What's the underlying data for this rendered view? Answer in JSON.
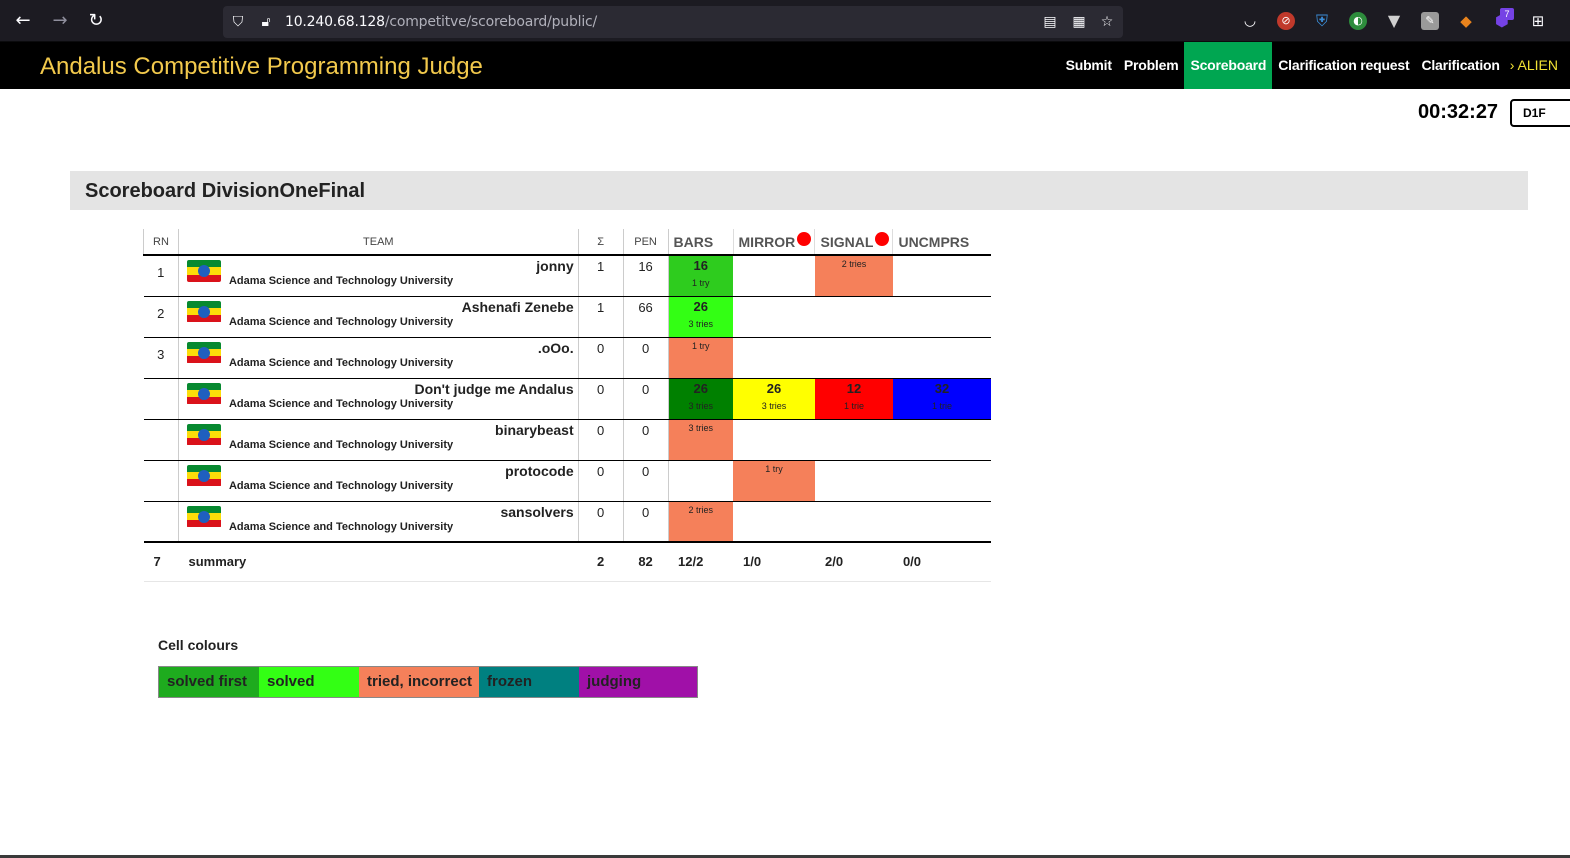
{
  "browser": {
    "url_host": "10.240.68.128",
    "url_path": "/competitve/scoreboard/public/",
    "extension_badge": "7"
  },
  "site": {
    "title": "Andalus Competitive Programming Judge",
    "nav": [
      "Submit",
      "Problem",
      "Scoreboard",
      "Clarification request",
      "Clarification"
    ],
    "active_nav": "Scoreboard",
    "user": "› ALIEN"
  },
  "clock": "00:32:27",
  "division": "D1F",
  "scoreboard": {
    "title": "Scoreboard DivisionOneFinal",
    "headers": {
      "rank": "RN",
      "team": "TEAM",
      "score": "Σ",
      "pen": "PEN"
    },
    "problems": [
      {
        "name": "BARS",
        "balloon": "#ffffff"
      },
      {
        "name": "MIRROR",
        "balloon": "#ff0000"
      },
      {
        "name": "SIGNAL",
        "balloon": "#ff0000"
      },
      {
        "name": "UNCMPRS",
        "balloon": "#ffffff"
      }
    ],
    "rows": [
      {
        "rank": "1",
        "team": "jonny",
        "affiliation": "Adama Science and Technology University",
        "score": "1",
        "pen": "16",
        "cells": [
          {
            "value": "16",
            "tries": "1 try",
            "color": "#2ecc1e"
          },
          {
            "value": "",
            "tries": "",
            "color": ""
          },
          {
            "value": "",
            "tries": "2 tries",
            "color": "#f5805a"
          },
          {
            "value": "",
            "tries": "",
            "color": ""
          }
        ]
      },
      {
        "rank": "2",
        "team": "Ashenafi Zenebe",
        "affiliation": "Adama Science and Technology University",
        "score": "1",
        "pen": "66",
        "cells": [
          {
            "value": "26",
            "tries": "3 tries",
            "color": "#33ff14"
          },
          {
            "value": "",
            "tries": "",
            "color": ""
          },
          {
            "value": "",
            "tries": "",
            "color": ""
          },
          {
            "value": "",
            "tries": "",
            "color": ""
          }
        ]
      },
      {
        "rank": "3",
        "team": ".oOo.",
        "affiliation": "Adama Science and Technology University",
        "score": "0",
        "pen": "0",
        "cells": [
          {
            "value": "",
            "tries": "1 try",
            "color": "#f5805a"
          },
          {
            "value": "",
            "tries": "",
            "color": ""
          },
          {
            "value": "",
            "tries": "",
            "color": ""
          },
          {
            "value": "",
            "tries": "",
            "color": ""
          }
        ]
      },
      {
        "rank": "",
        "team": "Don't judge me Andalus",
        "affiliation": "Adama Science and Technology University",
        "score": "0",
        "pen": "0",
        "cells": [
          {
            "value": "26",
            "tries": "3 tries",
            "color": "#008000"
          },
          {
            "value": "26",
            "tries": "3 tries",
            "color": "#ffff00"
          },
          {
            "value": "12",
            "tries": "1 trie",
            "color": "#ff0000"
          },
          {
            "value": "32",
            "tries": "1 trie",
            "color": "#0000ff"
          }
        ]
      },
      {
        "rank": "",
        "team": "binarybeast",
        "affiliation": "Adama Science and Technology University",
        "score": "0",
        "pen": "0",
        "cells": [
          {
            "value": "",
            "tries": "3 tries",
            "color": "#f5805a"
          },
          {
            "value": "",
            "tries": "",
            "color": ""
          },
          {
            "value": "",
            "tries": "",
            "color": ""
          },
          {
            "value": "",
            "tries": "",
            "color": ""
          }
        ]
      },
      {
        "rank": "",
        "team": "protocode",
        "affiliation": "Adama Science and Technology University",
        "score": "0",
        "pen": "0",
        "cells": [
          {
            "value": "",
            "tries": "",
            "color": ""
          },
          {
            "value": "",
            "tries": "1 try",
            "color": "#f5805a"
          },
          {
            "value": "",
            "tries": "",
            "color": ""
          },
          {
            "value": "",
            "tries": "",
            "color": ""
          }
        ]
      },
      {
        "rank": "",
        "team": "sansolvers",
        "affiliation": "Adama Science and Technology University",
        "score": "0",
        "pen": "0",
        "cells": [
          {
            "value": "",
            "tries": "2 tries",
            "color": "#f5805a"
          },
          {
            "value": "",
            "tries": "",
            "color": ""
          },
          {
            "value": "",
            "tries": "",
            "color": ""
          },
          {
            "value": "",
            "tries": "",
            "color": ""
          }
        ]
      }
    ],
    "summary": {
      "count": "7",
      "label": "summary",
      "score": "2",
      "pen": "82",
      "problems": [
        "12/2",
        "1/0",
        "2/0",
        "0/0"
      ]
    }
  },
  "legend": {
    "title": "Cell colours",
    "items": [
      {
        "label": "solved first",
        "color": "#1eab1e",
        "width": 100
      },
      {
        "label": "solved",
        "color": "#33ff14",
        "width": 100
      },
      {
        "label": "tried, incorrect",
        "color": "#f5805a",
        "width": 120
      },
      {
        "label": "frozen",
        "color": "#008080",
        "width": 100
      },
      {
        "label": "judging",
        "color": "#a010a8",
        "width": 118
      }
    ]
  }
}
